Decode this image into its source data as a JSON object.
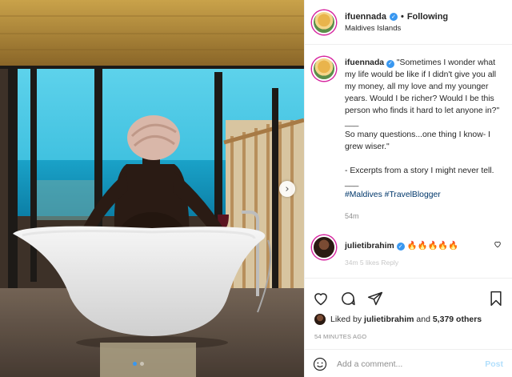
{
  "post": {
    "username": "ifuennada",
    "follow_status": "Following",
    "separator": "•",
    "location": "Maldives Islands",
    "caption_lines": "\"Sometimes I wonder what my life would be like if I didn't give you all my money, all my love and my younger years. Would I be richer? Would I be this person who finds it hard to let anyone in?\"\n___\nSo many questions...one thing I know- I grew wiser.\"\n\n- Excerpts from a story I might never tell.\n___",
    "hashtags": "#Maldives #TravelBlogger",
    "caption_time": "54m",
    "comment": {
      "username": "julietibrahim",
      "text": "🔥🔥🔥🔥🔥",
      "meta": "34m   5 likes   Reply"
    },
    "liked_by_prefix": "Liked by",
    "liked_by_user": "julietibrahim",
    "liked_by_and": "and",
    "liked_by_count": "5,379 others",
    "posted_ago": "54 MINUTES AGO",
    "add_comment_placeholder": "Add a comment...",
    "post_label": "Post",
    "carousel_next": "›"
  },
  "icons": {
    "verified": "verified-badge-icon",
    "like": "heart-icon",
    "comment": "comment-bubble-icon",
    "share": "paper-plane-icon",
    "save": "bookmark-icon",
    "emoji": "smiley-icon"
  },
  "colors": {
    "accent_blue": "#3897f0",
    "link": "#00376b",
    "post_disabled": "#b2dffc"
  }
}
